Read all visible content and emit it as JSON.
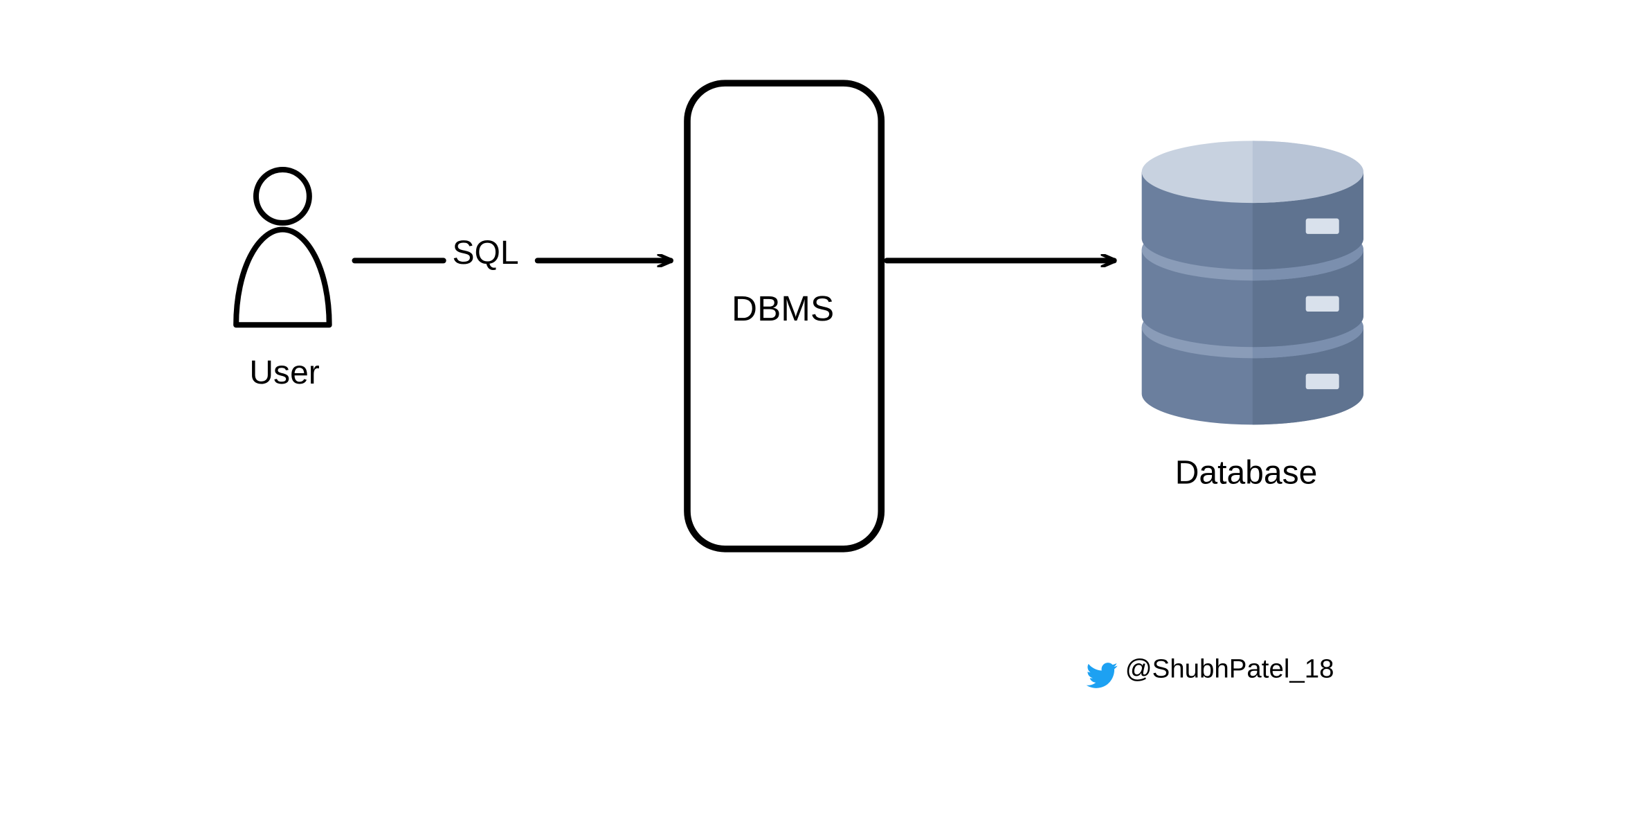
{
  "nodes": {
    "user": {
      "label": "User"
    },
    "dbms": {
      "label": "DBMS"
    },
    "database": {
      "label": "Database"
    }
  },
  "edges": {
    "user_to_dbms": {
      "label": "SQL"
    },
    "dbms_to_database": {
      "label": ""
    }
  },
  "credit": {
    "platform": "twitter",
    "handle": "@ShubhPatel_18"
  },
  "colors": {
    "stroke": "#000000",
    "db_light": "#c8d2e0",
    "db_mid": "#8a9cb8",
    "db_dark": "#6b7f9e",
    "db_slot": "#d9e1ec",
    "twitter": "#1da1f2"
  }
}
